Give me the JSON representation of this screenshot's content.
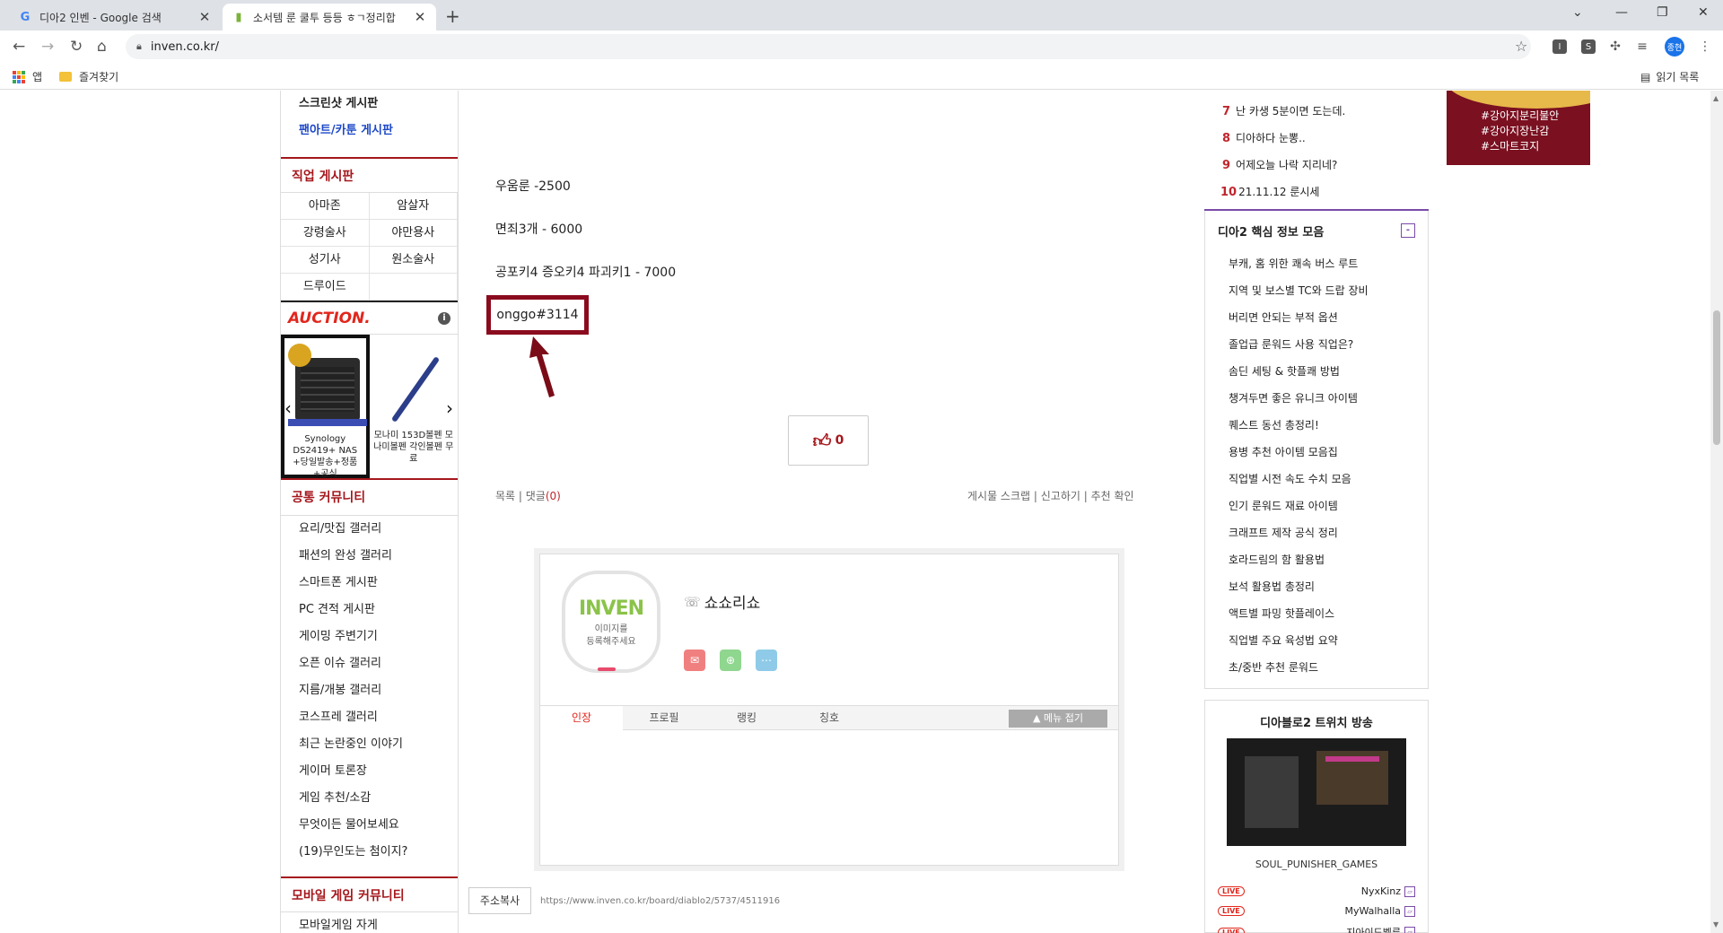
{
  "browser": {
    "tabs": [
      {
        "title": "디아2 인벤 - Google 검색",
        "favicon": "G"
      },
      {
        "title": "소서템 룬 쿨투 등등 ㅎㄱ정리합",
        "favicon": "i"
      }
    ],
    "url": "inven.co.kr/",
    "bookmarks": {
      "apps": "앱",
      "favorites": "즐겨찾기",
      "reading_list": "읽기 목록"
    },
    "profile_initials": "종현"
  },
  "left_nav": {
    "top_items": [
      "스크린샷 게시판",
      "팬아트/카툰 게시판"
    ],
    "job_section": "직업 게시판",
    "jobs": [
      "아마존",
      "암살자",
      "강령술사",
      "야만용사",
      "성기사",
      "원소술사",
      "드루이드",
      ""
    ],
    "auction": {
      "logo": "AUCTION.",
      "products": [
        {
          "caption": "Synology DS2419+ NAS +당일발송+정품+공식"
        },
        {
          "caption": "모나미 153D볼펜 모나미볼펜 각인볼펜 무료"
        }
      ]
    },
    "common_section": "공통 커뮤니티",
    "common_items": [
      "요리/맛집 갤러리",
      "패션의 완성 갤러리",
      "스마트폰 게시판",
      "PC 견적 게시판",
      "게이밍 주변기기",
      "오픈 이슈 갤러리",
      "지름/개봉 갤러리",
      "코스프레 갤러리",
      "최근 논란중인 이야기",
      "게이머 토론장",
      "게임 추천/소감",
      "무엇이든 물어보세요",
      "(19)무인도는 첨이지?"
    ],
    "mobile_section": "모바일 게임 커뮤니티",
    "mobile_items": [
      "모바일게임 자게"
    ]
  },
  "post": {
    "lines": [
      "우움룬 -2500",
      "면죄3개 - 6000",
      "공포키4 증오키4 파괴키1 - 7000"
    ],
    "highlight": "onggo#3114",
    "like_count": "0",
    "links_left": {
      "list": "목록",
      "comment": "댓글",
      "comment_count": "(0)"
    },
    "links_right": [
      "게시물 스크랩",
      "신고하기",
      "추천 확인"
    ],
    "profile": {
      "logo": "INVEN",
      "logo_sub": "이미지를\n등록해주세요",
      "nickname": "쇼쇼리쇼",
      "tabs": [
        "인장",
        "프로필",
        "랭킹",
        "칭호"
      ],
      "menu_fold": "▲ 메뉴 접기"
    },
    "copy_button": "주소복사",
    "address": "https://www.inven.co.kr/board/diablo2/5737/4511916"
  },
  "right_col": {
    "ranks": [
      {
        "n": "7",
        "t": "난 카생 5분이면 도는데."
      },
      {
        "n": "8",
        "t": "디아하다 눈뽕.."
      },
      {
        "n": "9",
        "t": "어제오늘 나락 지리네?"
      },
      {
        "n": "10",
        "t": "21.11.12 룬시세"
      }
    ],
    "info_title": "디아2 핵심 정보 모음",
    "info_items": [
      "부캐, 홈 위한 쾌속 버스 루트",
      "지역 및 보스별 TC와 드랍 장비",
      "버리면 안되는 부적 옵션",
      "졸업급 룬워드 사용 직업은?",
      "솜딘 세팅 & 핫플쾌 방법",
      "챙겨두면 좋은 유니크 아이템",
      "퀘스트 동선 총정리!",
      "용병 추천 아이템 모음집",
      "직업별 시전 속도 수치 모음",
      "인기 룬워드 재료 아이템",
      "크래프트 제작 공식 정리",
      "호라드림의 함 활용법",
      "보석 활용법 총정리",
      "액트별 파밍 핫플레이스",
      "직업별 주요 육성법 요약",
      "초/중반 추천 룬워드"
    ],
    "twitch_title": "디아블로2 트위치 방송",
    "twitch_channel": "SOUL_PUNISHER_GAMES",
    "streamers": [
      "NyxKinz",
      "MyWalhalla",
      "지아이드벨류"
    ],
    "live_label": "LIVE"
  },
  "ad": {
    "lines": [
      "#강아지분리불안",
      "#강아지장난감",
      "#스마트코지"
    ]
  }
}
